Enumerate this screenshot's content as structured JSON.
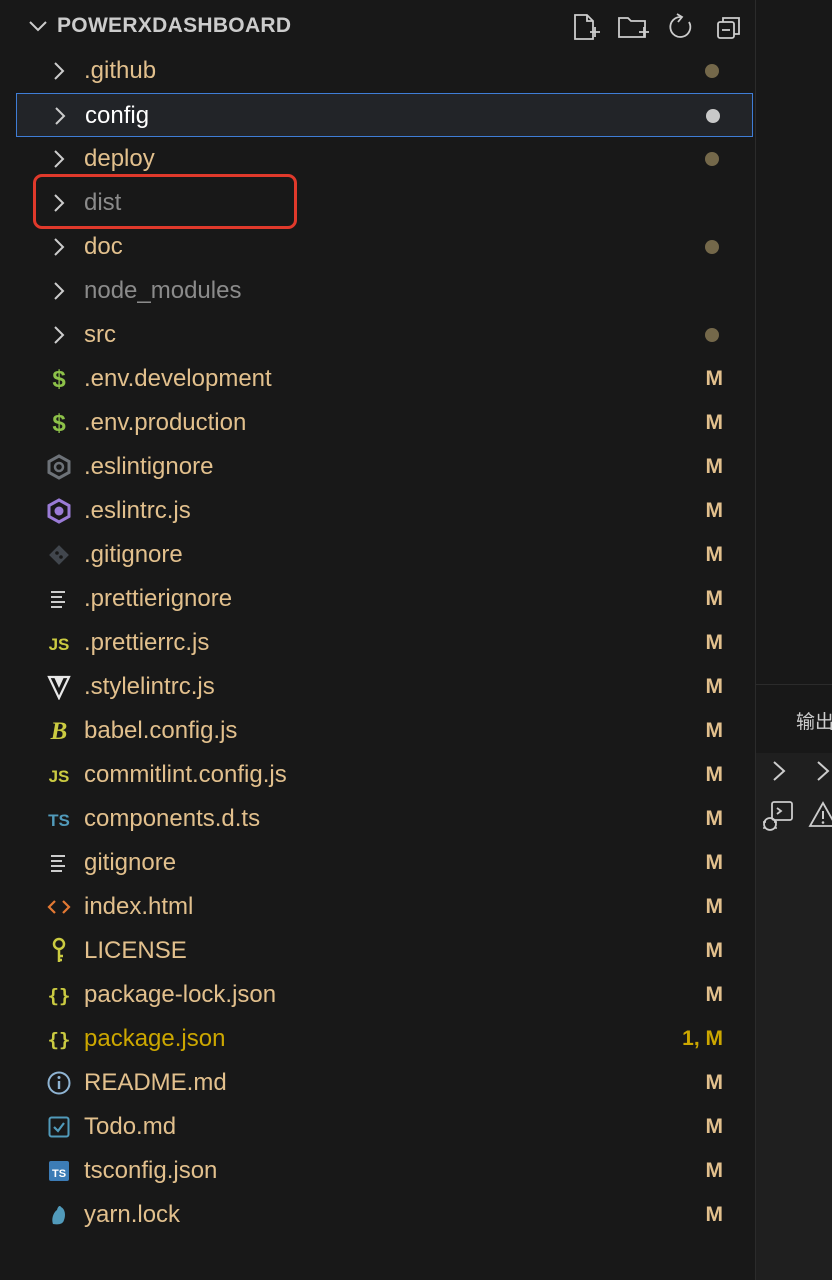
{
  "explorer": {
    "title": "POWERXDASHBOARD",
    "actions": [
      {
        "icon": "new-file-icon"
      },
      {
        "icon": "new-folder-icon"
      },
      {
        "icon": "refresh-icon"
      },
      {
        "icon": "collapse-all-icon"
      }
    ],
    "items": [
      {
        "label": ".github",
        "kind": "folder",
        "decoration": "dot",
        "style": "normal"
      },
      {
        "label": "config",
        "kind": "folder",
        "decoration": "dot",
        "style": "selected"
      },
      {
        "label": "deploy",
        "kind": "folder",
        "decoration": "dot",
        "style": "normal"
      },
      {
        "label": "dist",
        "kind": "folder",
        "decoration": "",
        "style": "ignored"
      },
      {
        "label": "doc",
        "kind": "folder",
        "decoration": "dot",
        "style": "normal"
      },
      {
        "label": "node_modules",
        "kind": "folder",
        "decoration": "",
        "style": "ignored"
      },
      {
        "label": "src",
        "kind": "folder",
        "decoration": "dot",
        "style": "normal"
      },
      {
        "label": ".env.development",
        "kind": "file",
        "icon": "dollar-icon",
        "decoration": "M",
        "style": "modified"
      },
      {
        "label": ".env.production",
        "kind": "file",
        "icon": "dollar-icon",
        "decoration": "M",
        "style": "modified"
      },
      {
        "label": ".eslintignore",
        "kind": "file",
        "icon": "eslint-ignore-icon",
        "decoration": "M",
        "style": "modified"
      },
      {
        "label": ".eslintrc.js",
        "kind": "file",
        "icon": "eslint-icon",
        "decoration": "M",
        "style": "modified"
      },
      {
        "label": ".gitignore",
        "kind": "file",
        "icon": "git-icon",
        "decoration": "M",
        "style": "modified"
      },
      {
        "label": ".prettierignore",
        "kind": "file",
        "icon": "lines-icon",
        "decoration": "M",
        "style": "modified"
      },
      {
        "label": ".prettierrc.js",
        "kind": "file",
        "icon": "javascript-icon",
        "decoration": "M",
        "style": "modified"
      },
      {
        "label": ".stylelintrc.js",
        "kind": "file",
        "icon": "stylelint-icon",
        "decoration": "M",
        "style": "modified"
      },
      {
        "label": "babel.config.js",
        "kind": "file",
        "icon": "babel-icon",
        "decoration": "M",
        "style": "modified"
      },
      {
        "label": "commitlint.config.js",
        "kind": "file",
        "icon": "javascript-icon",
        "decoration": "M",
        "style": "modified"
      },
      {
        "label": "components.d.ts",
        "kind": "file",
        "icon": "typescript-icon",
        "decoration": "M",
        "style": "modified"
      },
      {
        "label": "gitignore",
        "kind": "file",
        "icon": "lines-icon",
        "decoration": "M",
        "style": "modified"
      },
      {
        "label": "index.html",
        "kind": "file",
        "icon": "html-icon",
        "decoration": "M",
        "style": "modified"
      },
      {
        "label": "LICENSE",
        "kind": "file",
        "icon": "license-icon",
        "decoration": "M",
        "style": "modified"
      },
      {
        "label": "package-lock.json",
        "kind": "file",
        "icon": "json-icon",
        "decoration": "M",
        "style": "modified"
      },
      {
        "label": "package.json",
        "kind": "file",
        "icon": "json-icon",
        "decoration": "1, M",
        "style": "warning"
      },
      {
        "label": "README.md",
        "kind": "file",
        "icon": "info-icon",
        "decoration": "M",
        "style": "modified"
      },
      {
        "label": "Todo.md",
        "kind": "file",
        "icon": "checkbox-icon",
        "decoration": "M",
        "style": "modified"
      },
      {
        "label": "tsconfig.json",
        "kind": "file",
        "icon": "tsconfig-icon",
        "decoration": "M",
        "style": "modified"
      },
      {
        "label": "yarn.lock",
        "kind": "file",
        "icon": "yarn-icon",
        "decoration": "M",
        "style": "modified"
      }
    ]
  },
  "panel": {
    "tab_label": "输出"
  },
  "colors": {
    "modified": "#e2c08d",
    "ignored": "#8b8b8b",
    "warning": "#cca700",
    "highlight": "#e0392b",
    "selection_border": "#3f7dd6"
  }
}
